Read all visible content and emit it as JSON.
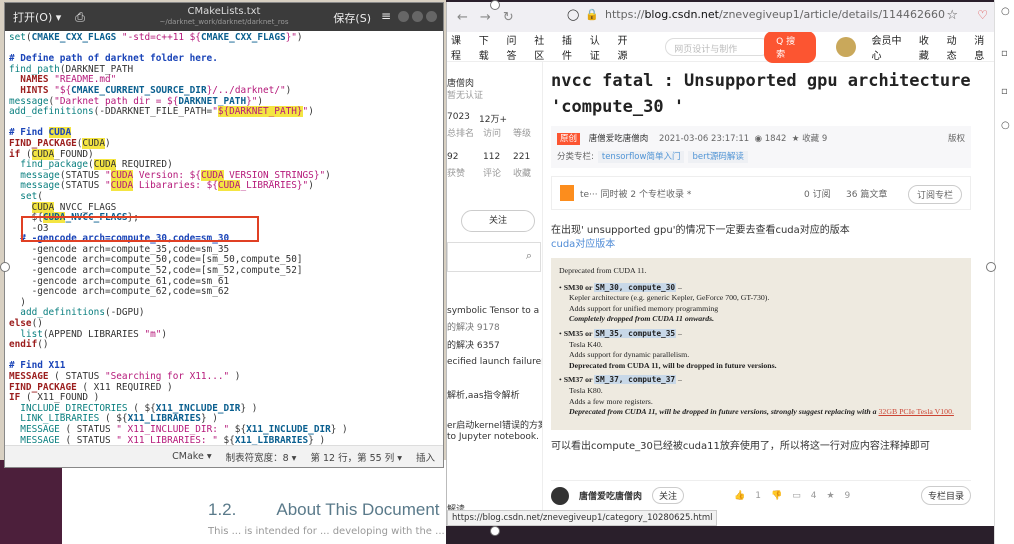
{
  "editor": {
    "open_label": "打开(O)",
    "open_arrow": "▾",
    "file_name": "CMakeLists.txt",
    "file_path": "~/darknet_work/darknet/darknet_ros",
    "save_label": "保存(S)",
    "menu_icon": "≡",
    "status": {
      "language": "CMake ▾",
      "tab_width": "制表符宽度：8 ▾",
      "cursor": "第 12 行，第 55 列 ▾",
      "mode": "插入"
    }
  },
  "doc": {
    "heading_num": "1.2.",
    "heading": "About This Document",
    "sub": "This ... is intended for ... developing with the ..."
  },
  "browser": {
    "nav_back": "←",
    "nav_fwd": "→",
    "reload": "↻",
    "url_domain": "blog.csdn.net",
    "url_prefix": "https://",
    "url_path": "/znevegiveup1/article/details/114462660",
    "status_url": "https://blog.csdn.net/znevegiveup1/category_10280625.html"
  },
  "csdn_nav": {
    "items": [
      "课程",
      "下载",
      "问答",
      "社区",
      "插件",
      "认证",
      "开源"
    ],
    "search_placeholder": "网页设计与制作",
    "search_button": "Q 搜索",
    "right": [
      "会员中心",
      "收藏",
      "动态",
      "消息"
    ]
  },
  "sidebar": {
    "name": "唐僧肉",
    "cert": "暂无认证",
    "stats1": [
      "7023",
      "12万+"
    ],
    "labels1": [
      "总排名",
      "访问",
      "等级"
    ],
    "stats2": [
      "92",
      "112",
      "221"
    ],
    "labels2": [
      "获赞",
      "评论",
      "收藏"
    ],
    "follow": "关注",
    "related": [
      {
        "text": "symbolic Tensor to a",
        "sub": "的解决 9178"
      },
      {
        "text": "的解决 6357",
        "sub": ""
      },
      {
        "text": "ecified launch failure问",
        "sub": ""
      },
      {
        "text": "解析,aas指令解析",
        "sub": ""
      },
      {
        "text": "er启动kernel错误的方案",
        "sub": "to Jupyter notebook."
      }
    ],
    "bottom": "解读"
  },
  "article": {
    "title": "nvcc fatal : Unsupported gpu architecture  'compute_30 '",
    "original_tag": "原创",
    "author": "唐僧爱吃唐僧肉",
    "date": "2021-03-06 23:17:11",
    "views": "1842",
    "favs": "收藏 9",
    "copyright": "版权",
    "column_label": "分类专栏:",
    "tags": [
      "tensorflow简单入门",
      "bert源码解读"
    ],
    "column_card": "te···  同时被 2 个专栏收录 *",
    "column_stats": [
      "0 订阅",
      "36 篇文章"
    ],
    "column_sub": "订阅专栏",
    "intro": "在出现' unsupported gpu'的情况下一定要去查看cuda对应的版本",
    "intro_link": "cuda对应版本",
    "quote_title": "Deprecated from CUDA 11.",
    "quote_items": [
      {
        "head": "SM30 or ",
        "code": "SM_30, compute_30",
        "lines": [
          "Kepler architecture (e.g. generic Kepler, GeForce 700, GT-730).",
          "Adds support for unified memory programming"
        ],
        "bold": "Completely dropped from CUDA 11 onwards."
      },
      {
        "head": "SM35 or ",
        "code": "SM_35, compute_35",
        "lines": [
          "Tesla K40.",
          "Adds support for dynamic parallelism."
        ],
        "bold": "Deprecated from CUDA 11, will be dropped in future versions."
      },
      {
        "head": "SM37 or ",
        "code": "SM_37, compute_37",
        "lines": [
          "Tesla K80.",
          "Adds a few more registers."
        ],
        "bold": "Deprecated from CUDA 11, will be dropped in future versions, strongly suggest replacing with a ",
        "link": "32GB PCIe Tesla V100."
      }
    ],
    "conclusion": "可以看出compute_30已经被cuda11放弃使用了，所以将这一行对应内容注释掉即可",
    "bottom_author": "唐僧爱吃唐僧肉",
    "bottom_follow": "关注",
    "bottom_stats": [
      "1",
      "4",
      "9"
    ],
    "bottom_toc": "专栏目录"
  }
}
